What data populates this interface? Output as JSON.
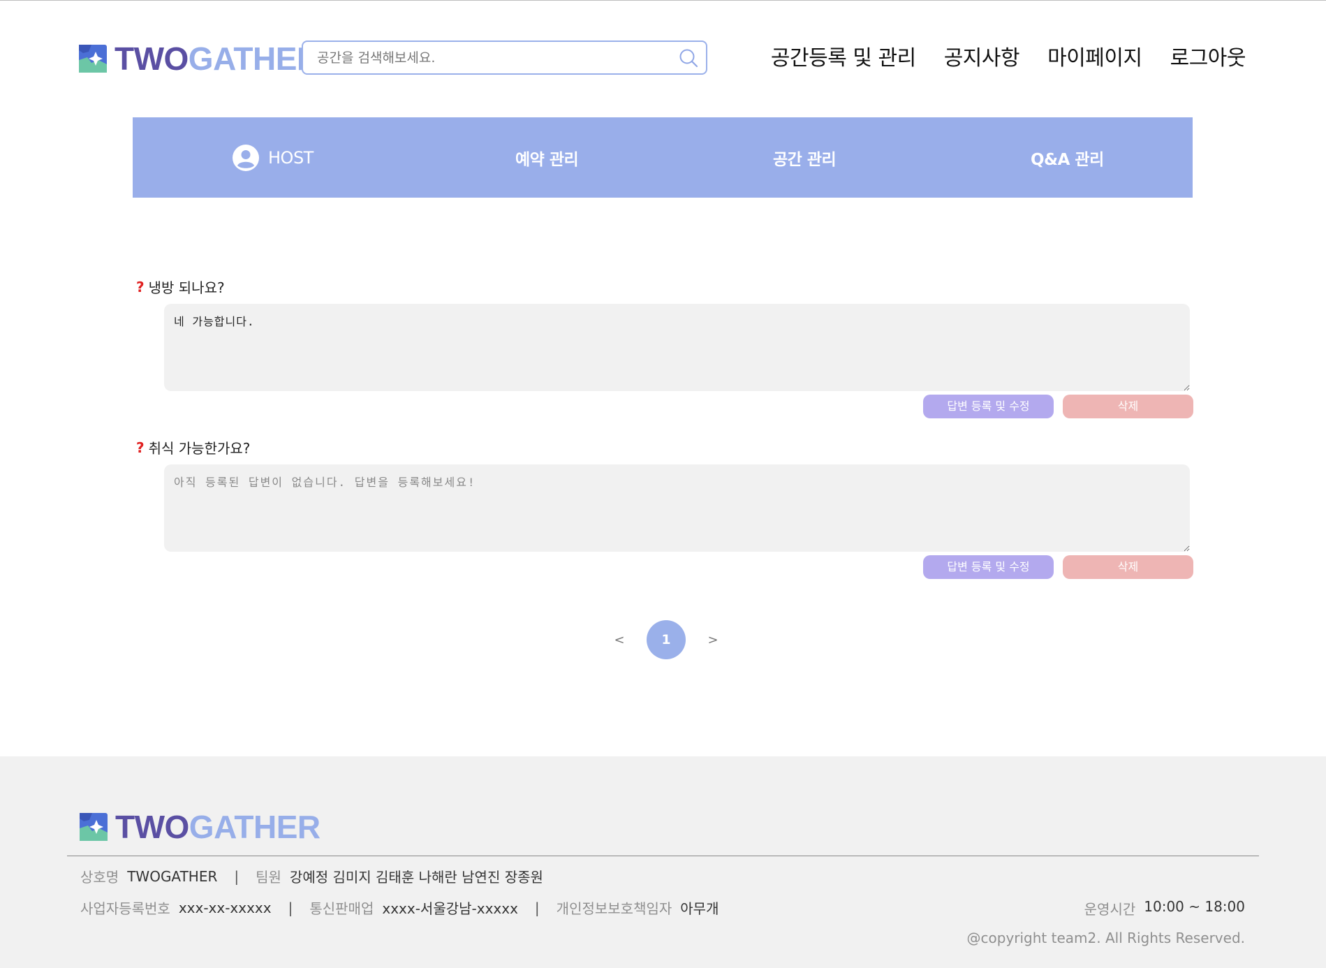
{
  "brand": {
    "name_part1": "TWO",
    "name_part2": "GATHER"
  },
  "search": {
    "placeholder": "공간을 검색해보세요."
  },
  "nav": {
    "items": [
      {
        "label": "공간등록 및 관리"
      },
      {
        "label": "공지사항"
      },
      {
        "label": "마이페이지"
      },
      {
        "label": "로그아웃"
      }
    ]
  },
  "host_menu": {
    "host_label": "HOST",
    "reservation": "예약 관리",
    "space": "공간 관리",
    "qa": "Q&A 관리"
  },
  "qa_list": [
    {
      "question": "냉방 되나요?",
      "answer": "네 가능합니다.",
      "placeholder": "",
      "save_label": "답변 등록 및 수정",
      "delete_label": "삭제"
    },
    {
      "question": "취식 가능한가요?",
      "answer": "",
      "placeholder": "아직 등록된 답변이 없습니다. 답변을 등록해보세요!",
      "save_label": "답변 등록 및 수정",
      "delete_label": "삭제"
    }
  ],
  "pagination": {
    "prev": "<",
    "current": "1",
    "next": ">"
  },
  "footer": {
    "company_label": "상호명",
    "company_value": "TWOGATHER",
    "team_label": "팀원",
    "team_value": "강예정 김미지 김태훈 나해란 남연진 장종원",
    "biz_label": "사업자등록번호",
    "biz_value": "xxx-xx-xxxxx",
    "mail_label": "통신판매업",
    "mail_value": "xxxx-서울강남-xxxxx",
    "privacy_label": "개인정보보호책임자",
    "privacy_value": "아무개",
    "hours_label": "운영시간",
    "hours_value": "10:00 ~ 18:00",
    "copyright": "@copyright team2. All Rights Reserved.",
    "separator": "|"
  },
  "colors": {
    "accent": "#99aeea",
    "brand_dark": "#5a4fa3",
    "save_button": "#b3a9ee",
    "delete_button": "#eeb5b4",
    "question_mark": "#e02020"
  }
}
